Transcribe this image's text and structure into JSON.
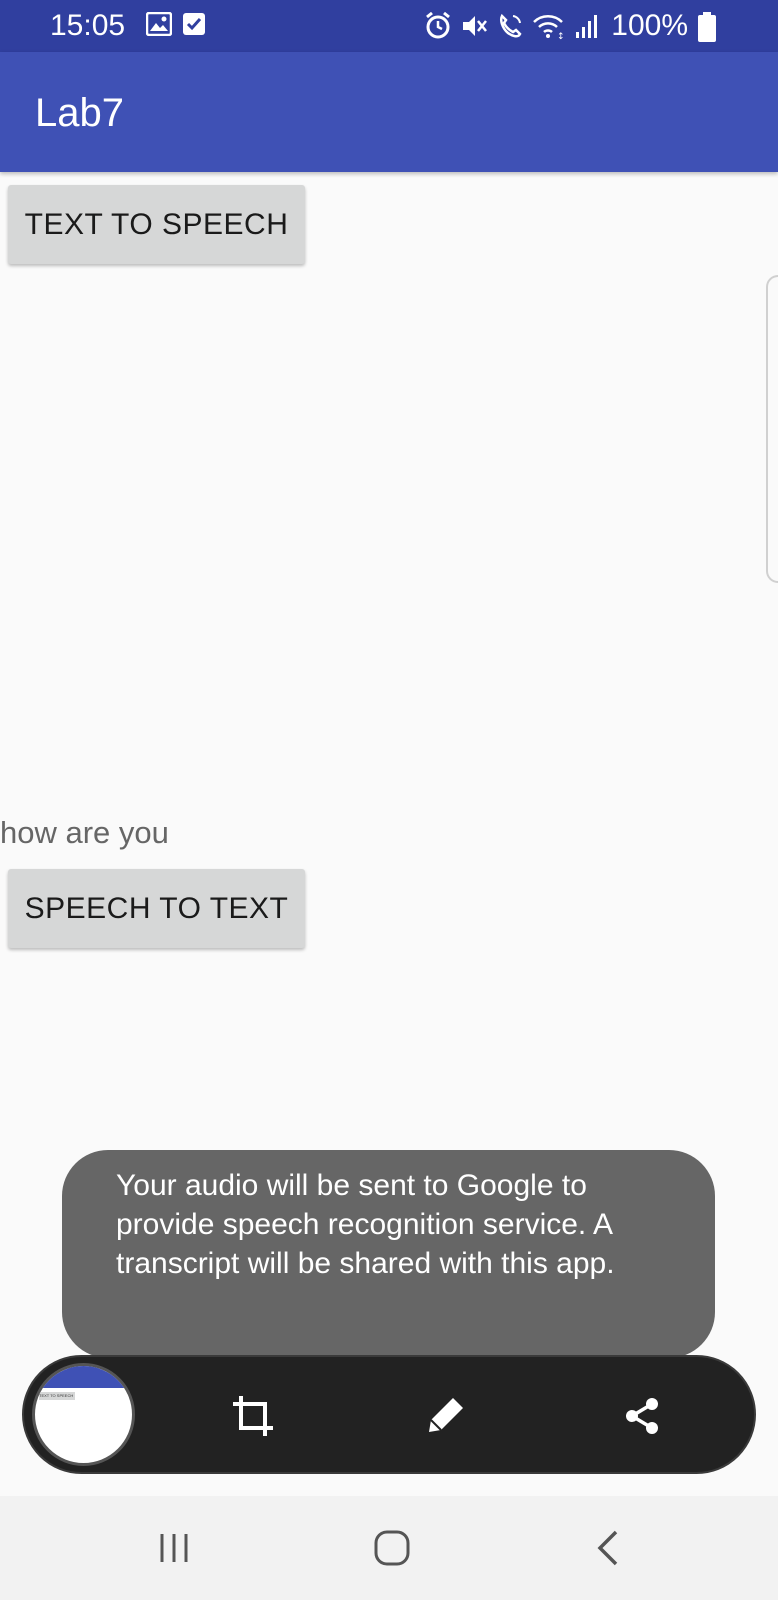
{
  "status_bar": {
    "time": "15:05",
    "battery": "100%",
    "icons_left": [
      "image-icon",
      "check-box-icon"
    ],
    "icons_right": [
      "alarm-icon",
      "mute-icon",
      "wifi-call-icon",
      "wifi-icon",
      "signal-icon",
      "battery-icon"
    ]
  },
  "toolbar": {
    "title": "Lab7",
    "color": "#3f51b5",
    "status_color": "#303f9f"
  },
  "main": {
    "tts_button_label": "TEXT TO SPEECH",
    "result_text": "how are you",
    "stt_button_label": "SPEECH TO TEXT"
  },
  "toast": {
    "message": "Your audio will be sent to Google to provide speech recognition service. A transcript will be shared with this app."
  },
  "screenshot_toolbar": {
    "thumbnail_button_text": "TEXT TO SPEECH",
    "icons": [
      "crop-icon",
      "edit-icon",
      "share-icon"
    ]
  },
  "nav_bar": {
    "icons": [
      "recent-apps-icon",
      "home-icon",
      "back-icon"
    ]
  }
}
